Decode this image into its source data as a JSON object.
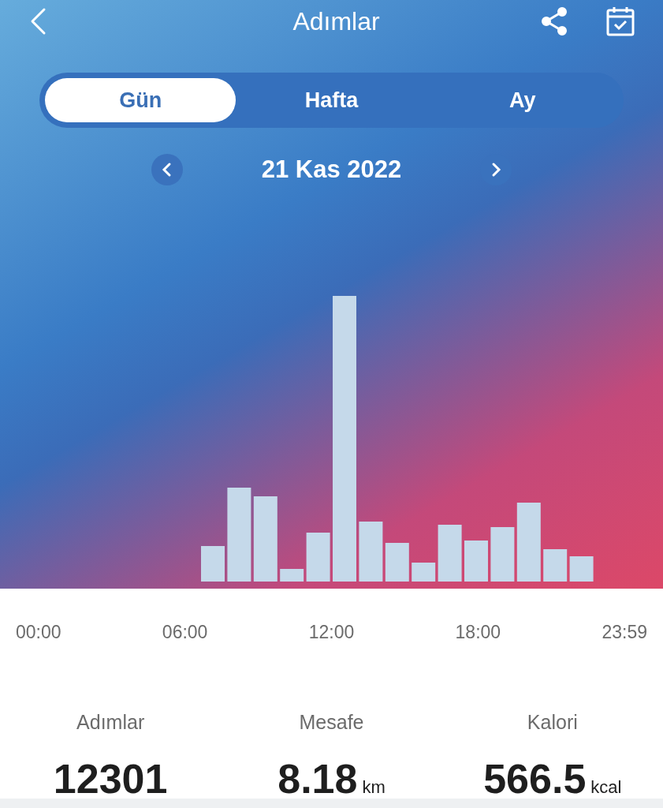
{
  "header": {
    "title": "Adımlar"
  },
  "tabs": [
    {
      "label": "Gün",
      "selected": true
    },
    {
      "label": "Hafta",
      "selected": false
    },
    {
      "label": "Ay",
      "selected": false
    }
  ],
  "date": "21 Kas 2022",
  "time_labels": [
    "00:00",
    "06:00",
    "12:00",
    "18:00",
    "23:59"
  ],
  "stats": [
    {
      "label": "Adımlar",
      "value": "12301"
    },
    {
      "label": "Mesafe",
      "value": "8.18",
      "unit": "km"
    },
    {
      "label": "Kalori",
      "value": "566.5",
      "unit": "kcal"
    }
  ]
}
